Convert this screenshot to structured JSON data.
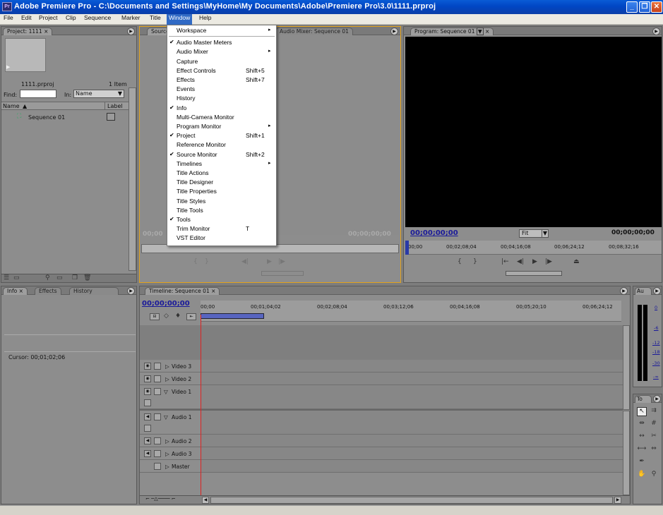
{
  "window": {
    "title": "Adobe Premiere Pro - C:\\Documents and Settings\\MyHome\\My Documents\\Adobe\\Premiere Pro\\3.0\\1111.prproj",
    "app_icon": "Pr"
  },
  "menubar": [
    "File",
    "Edit",
    "Project",
    "Clip",
    "Sequence",
    "Marker",
    "Title",
    "Window",
    "Help"
  ],
  "project": {
    "tab": "Project: 1111",
    "close": "×",
    "file": "1111.prproj",
    "count": "1 Item",
    "find_label": "Find:",
    "in_label": "In:",
    "in_value": "Name",
    "col_name": "Name",
    "col_label": "Label",
    "item": "Sequence 01"
  },
  "source": {
    "tab": "Source",
    "audio_tab": "Audio Mixer: Sequence 01",
    "tc_left": "00;00",
    "tc_right": "00;00;00;00"
  },
  "program": {
    "tab": "Program: Sequence 01",
    "close": "×",
    "tc_left": "00;00;00;00",
    "tc_right": "00;00;00;00",
    "fit": "Fit",
    "ruler": [
      "00;00",
      "00;02;08;04",
      "00;04;16;08",
      "00;06;24;12",
      "00;08;32;16"
    ]
  },
  "info": {
    "tabs": [
      "Info",
      "Effects",
      "History"
    ],
    "close": "×",
    "cursor": "Cursor: 00;01;02;06"
  },
  "timeline": {
    "tab": "Timeline: Sequence 01",
    "close": "×",
    "tc": "00;00;00;00",
    "ruler": [
      "00;00",
      "00;01;04;02",
      "00;02;08;04",
      "00;03;12;06",
      "00;04;16;08",
      "00;05;20;10",
      "00;06;24;12"
    ],
    "tracks": [
      "Video 3",
      "Video 2",
      "Video 1",
      "Audio 1",
      "Audio 2",
      "Audio 3",
      "Master"
    ]
  },
  "audio_meters": {
    "tab": "Au",
    "labels": [
      "0",
      "-6",
      "-12",
      "-18",
      "-30",
      "-∞"
    ]
  },
  "tools": {
    "tab": "To"
  },
  "window_menu": [
    {
      "label": "Workspace",
      "checked": false,
      "shortcut": "",
      "submenu": true
    },
    {
      "label": "Audio Master Meters",
      "checked": true,
      "shortcut": "",
      "submenu": false
    },
    {
      "label": "Audio Mixer",
      "checked": false,
      "shortcut": "",
      "submenu": true
    },
    {
      "label": "Capture",
      "checked": false,
      "shortcut": "",
      "submenu": false
    },
    {
      "label": "Effect Controls",
      "checked": false,
      "shortcut": "Shift+5",
      "submenu": false
    },
    {
      "label": "Effects",
      "checked": false,
      "shortcut": "Shift+7",
      "submenu": false
    },
    {
      "label": "Events",
      "checked": false,
      "shortcut": "",
      "submenu": false
    },
    {
      "label": "History",
      "checked": false,
      "shortcut": "",
      "submenu": false
    },
    {
      "label": "Info",
      "checked": true,
      "shortcut": "",
      "submenu": false
    },
    {
      "label": "Multi-Camera Monitor",
      "checked": false,
      "shortcut": "",
      "submenu": false
    },
    {
      "label": "Program Monitor",
      "checked": false,
      "shortcut": "",
      "submenu": true
    },
    {
      "label": "Project",
      "checked": true,
      "shortcut": "Shift+1",
      "submenu": false
    },
    {
      "label": "Reference Monitor",
      "checked": false,
      "shortcut": "",
      "submenu": false
    },
    {
      "label": "Source Monitor",
      "checked": true,
      "shortcut": "Shift+2",
      "submenu": false
    },
    {
      "label": "Timelines",
      "checked": false,
      "shortcut": "",
      "submenu": true
    },
    {
      "label": "Title Actions",
      "checked": false,
      "shortcut": "",
      "submenu": false
    },
    {
      "label": "Title Designer",
      "checked": false,
      "shortcut": "",
      "submenu": false
    },
    {
      "label": "Title Properties",
      "checked": false,
      "shortcut": "",
      "submenu": false
    },
    {
      "label": "Title Styles",
      "checked": false,
      "shortcut": "",
      "submenu": false
    },
    {
      "label": "Title Tools",
      "checked": false,
      "shortcut": "",
      "submenu": false
    },
    {
      "label": "Tools",
      "checked": true,
      "shortcut": "",
      "submenu": false
    },
    {
      "label": "Trim Monitor",
      "checked": false,
      "shortcut": "T",
      "submenu": false
    },
    {
      "label": "VST Editor",
      "checked": false,
      "shortcut": "",
      "submenu": false
    }
  ],
  "glyphs": {
    "check": "✔",
    "arrow": "▸",
    "menu": "▶",
    "drop": "▼",
    "sort": "▲",
    "eye": "◉",
    "tri_right": "▷",
    "tri_down": "▽",
    "speaker": "◀",
    "hand": "✋",
    "zoom": "🔍",
    "sel": "➤"
  }
}
